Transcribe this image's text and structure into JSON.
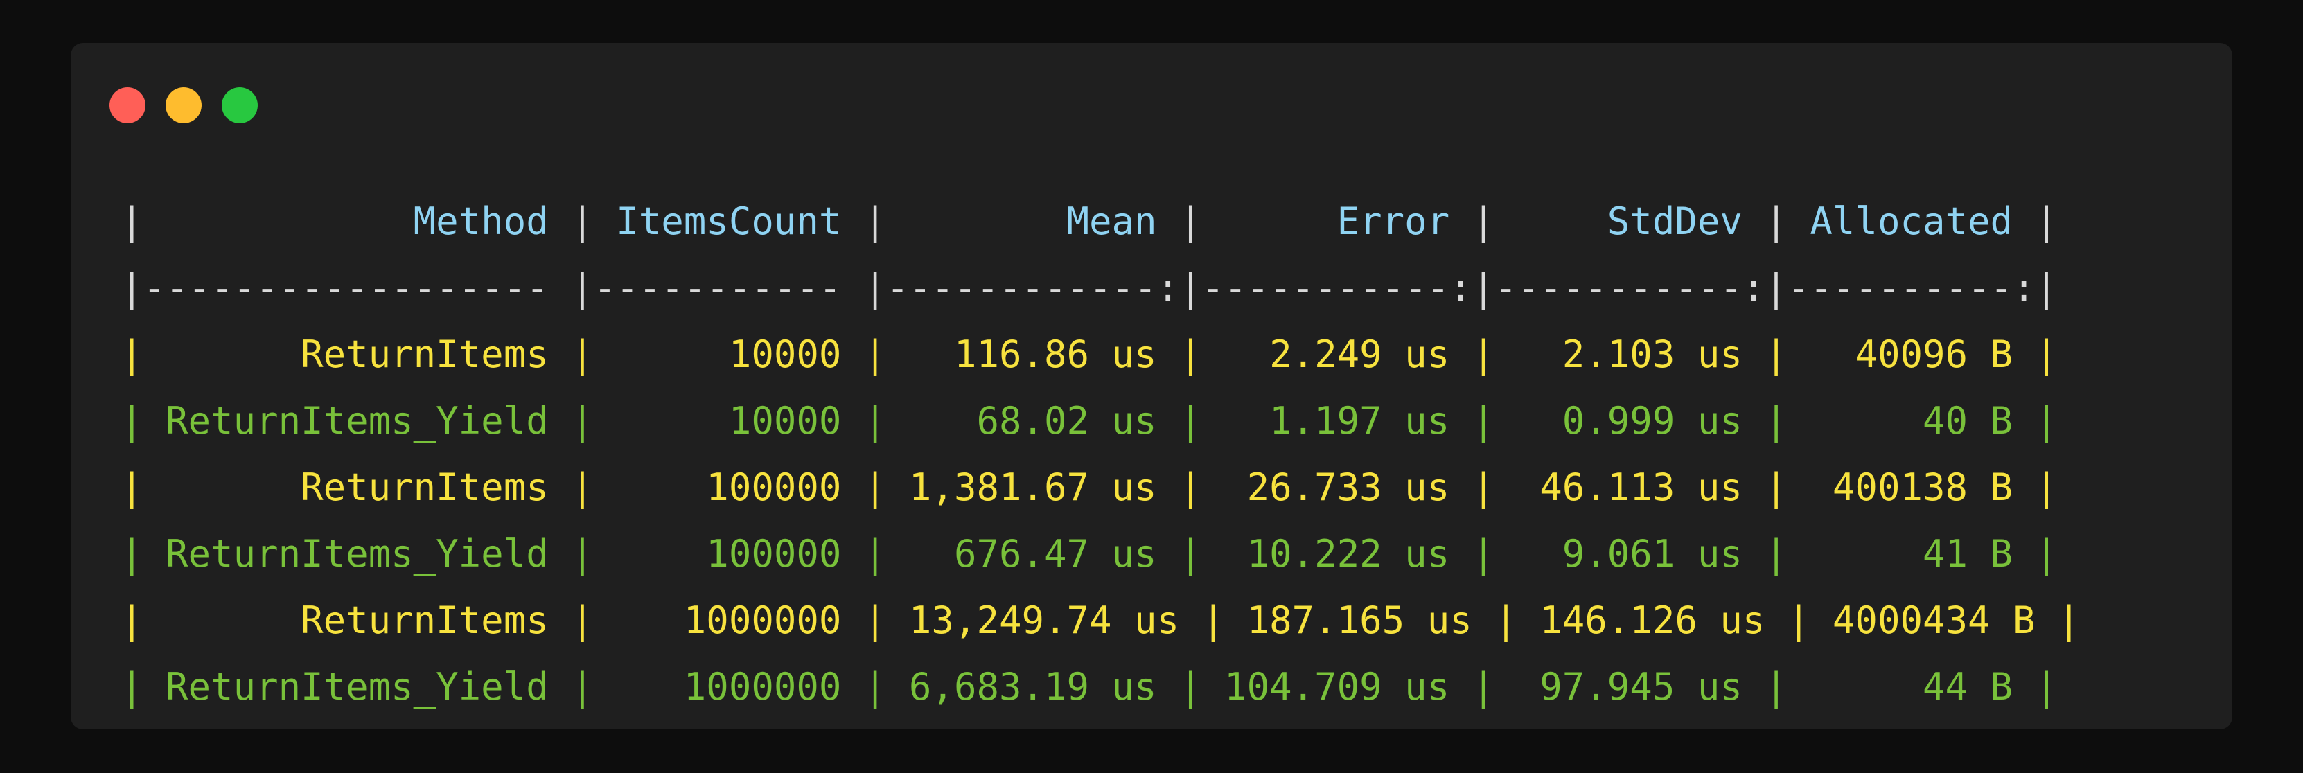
{
  "window": {
    "buttons": [
      {
        "name": "close",
        "color": "#ff5f57"
      },
      {
        "name": "minimize",
        "color": "#febc2e"
      },
      {
        "name": "maximize",
        "color": "#28c840"
      }
    ]
  },
  "table": {
    "columns": [
      {
        "label": "Method",
        "width": 17,
        "align": "right"
      },
      {
        "label": "ItemsCount",
        "width": 10,
        "align": "right"
      },
      {
        "label": "Mean",
        "width": 11,
        "align": "right"
      },
      {
        "label": "Error",
        "width": 10,
        "align": "right"
      },
      {
        "label": "StdDev",
        "width": 10,
        "align": "right"
      },
      {
        "label": "Allocated",
        "width": 9,
        "align": "right"
      }
    ],
    "rows": [
      {
        "color": "#f7e23e",
        "cells": [
          "ReturnItems",
          "10000",
          "116.86 us",
          "2.249 us",
          "2.103 us",
          "40096 B"
        ]
      },
      {
        "color": "#79c13a",
        "cells": [
          "ReturnItems_Yield",
          "10000",
          "68.02 us",
          "1.197 us",
          "0.999 us",
          "40 B"
        ]
      },
      {
        "color": "#f7e23e",
        "cells": [
          "ReturnItems",
          "100000",
          "1,381.67 us",
          "26.733 us",
          "46.113 us",
          "400138 B"
        ]
      },
      {
        "color": "#79c13a",
        "cells": [
          "ReturnItems_Yield",
          "100000",
          "676.47 us",
          "10.222 us",
          "9.061 us",
          "41 B"
        ]
      },
      {
        "color": "#f7e23e",
        "cells": [
          "ReturnItems",
          "1000000",
          "13,249.74 us",
          "187.165 us",
          "146.126 us",
          "4000434 B"
        ]
      },
      {
        "color": "#79c13a",
        "cells": [
          "ReturnItems_Yield",
          "1000000",
          "6,683.19 us",
          "104.709 us",
          "97.945 us",
          "44 B"
        ]
      }
    ],
    "header_color": "#8fd3f2",
    "border_color": "#d9d9d9"
  }
}
